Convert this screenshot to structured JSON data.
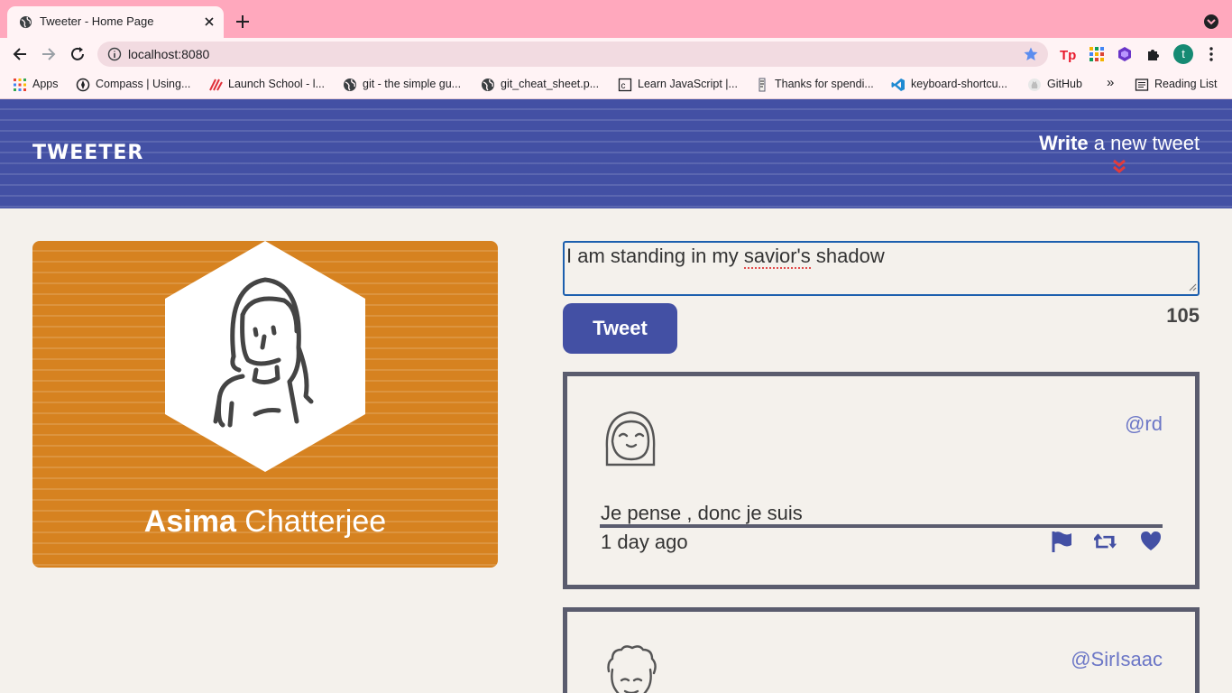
{
  "browser": {
    "tab_title": "Tweeter - Home Page",
    "url": "localhost:8080",
    "profile_initial": "t",
    "bookmarks": [
      {
        "label": "Apps",
        "icon": "apps-grid-icon"
      },
      {
        "label": "Compass | Using...",
        "icon": "compass-icon"
      },
      {
        "label": "Launch School - l...",
        "icon": "launch-school-icon"
      },
      {
        "label": "git - the simple gu...",
        "icon": "globe-icon"
      },
      {
        "label": "git_cheat_sheet.p...",
        "icon": "globe-icon"
      },
      {
        "label": "Learn JavaScript |...",
        "icon": "codecademy-icon"
      },
      {
        "label": "Thanks for spendi...",
        "icon": "page-icon"
      },
      {
        "label": "keyboard-shortcu...",
        "icon": "vscode-icon"
      },
      {
        "label": "GitHub",
        "icon": "github-icon"
      }
    ],
    "reading_list": "Reading List",
    "overflow": "»"
  },
  "header": {
    "brand": "TWEETER",
    "compose_bold": "Write",
    "compose_rest": " a new tweet"
  },
  "profile": {
    "first_name": "Asima",
    "last_name": " Chatterjee"
  },
  "composer": {
    "text_before": "I am standing in my ",
    "text_misspelled": "savior's",
    "text_after": " shadow",
    "button": "Tweet",
    "counter": "105"
  },
  "tweets": [
    {
      "handle": "@rd",
      "text": "Je pense , donc je suis",
      "time": "1 day ago"
    },
    {
      "handle": "@SirIsaac"
    }
  ],
  "colors": {
    "header_bg": "#4350a4",
    "profile_bg": "#d68220",
    "accent": "#4350a4",
    "handle": "#6b76c6",
    "chevron": "#e23b3b",
    "page_bg": "#f4f1ec",
    "tab_strip": "#ffa8bd"
  }
}
